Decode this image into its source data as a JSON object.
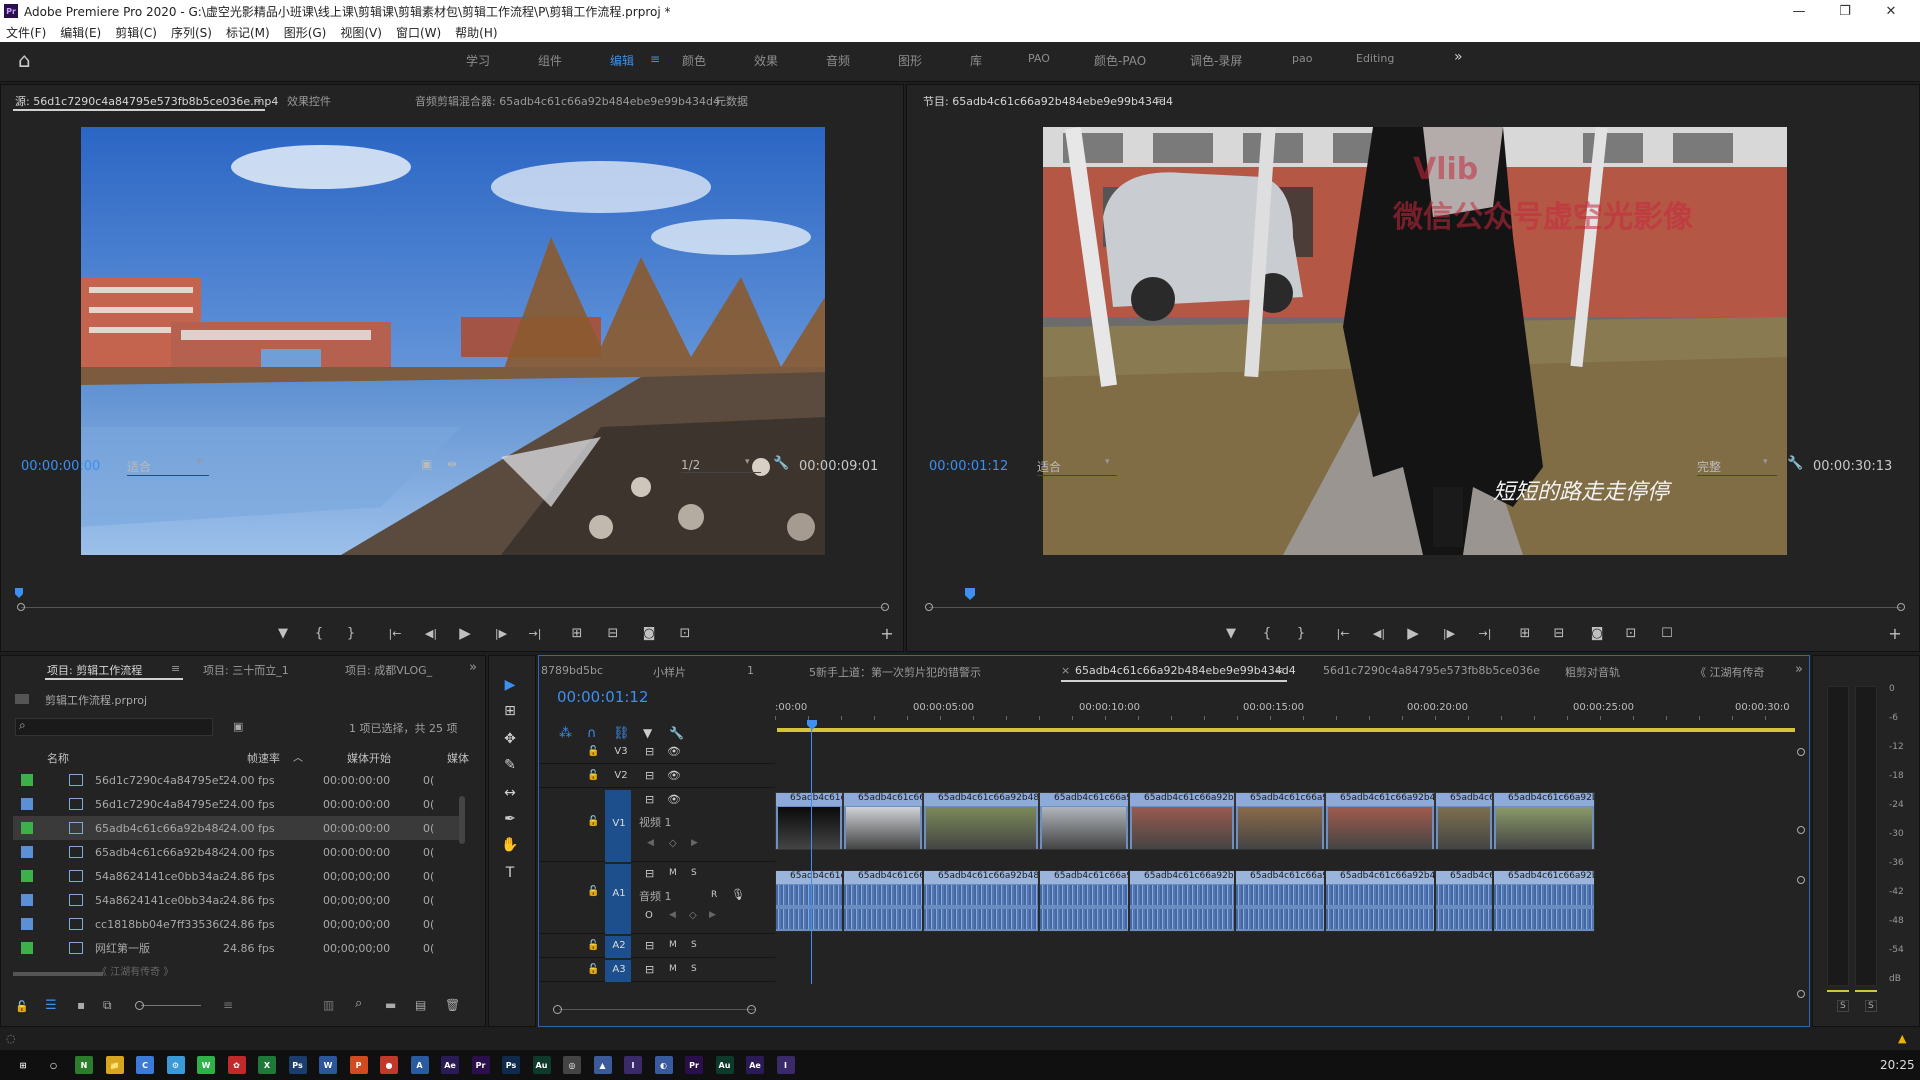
{
  "titlebar": {
    "app_icon": "Pr",
    "title": "Adobe Premiere Pro 2020 - G:\\虚空光影精品小班课\\线上课\\剪辑课\\剪辑素材包\\剪辑工作流程\\P\\剪辑工作流程.prproj *",
    "minimize": "—",
    "maximize": "❐",
    "close": "✕"
  },
  "menubar": [
    "文件(F)",
    "编辑(E)",
    "剪辑(C)",
    "序列(S)",
    "标记(M)",
    "图形(G)",
    "视图(V)",
    "窗口(W)",
    "帮助(H)"
  ],
  "workspaces": {
    "home_icon": "⌂",
    "tabs": [
      "学习",
      "组件",
      "编辑",
      "颜色",
      "效果",
      "音频",
      "图形",
      "库",
      "PAO",
      "颜色-PAO",
      "调色-录屏",
      "pao",
      "Editing"
    ],
    "active": "编辑",
    "active_menu": "≡",
    "overflow": "»"
  },
  "source_monitor": {
    "tabs": [
      "源: 56d1c7290c4a84795e573fb8b5ce036e.mp4",
      "效果控件",
      "音频剪辑混合器: 65adb4c61c66a92b484ebe9e99b434d4",
      "元数据"
    ],
    "tab_menu": "≡",
    "timecode": "00:00:00:00",
    "fit": "适合",
    "resolution": "1/2",
    "duration": "00:00:09:01"
  },
  "program_monitor": {
    "tab": "节目: 65adb4c61c66a92b484ebe9e99b434d4",
    "tab_menu": "≡",
    "timecode": "00:00:01:12",
    "fit": "适合",
    "quality": "完整",
    "duration": "00:00:30:13",
    "watermark_line1": "Vlib",
    "watermark_line2": "微信公众号虚空光影像",
    "subtitle": "短短的路走走停停"
  },
  "transport": {
    "marker": "▼",
    "in": "{",
    "out": "}",
    "goto_in": "|←",
    "step_back": "◀|",
    "play": "▶",
    "step_fwd": "|▶",
    "goto_out": "→|",
    "insert": "⊞",
    "overwrite": "⊟",
    "export_frame": "◙",
    "compare": "⊡",
    "add": "+"
  },
  "project_panel": {
    "tabs": [
      "项目: 剪辑工作流程",
      "项目: 三十而立_1",
      "项目: 成都VLOG_"
    ],
    "tab_menu": "≡",
    "overflow": "»",
    "project_file": "剪辑工作流程.prproj",
    "selection_info": "1 项已选择，共 25 项",
    "search_icon": "⌕",
    "col_name": "名称",
    "col_fps": "帧速率",
    "col_start": "媒体开始",
    "col_extra": "媒体",
    "rows": [
      {
        "name": "56d1c7290c4a84795e5",
        "fps": "24.00 fps",
        "start": "00:00:00:00",
        "swatch": "#3db04a",
        "kind": "seq"
      },
      {
        "name": "56d1c7290c4a84795e5",
        "fps": "24.00 fps",
        "start": "00:00:00:00",
        "swatch": "#5b8fd6",
        "kind": "clip"
      },
      {
        "name": "65adb4c61c66a92b484",
        "fps": "24.00 fps",
        "start": "00:00:00:00",
        "swatch": "#3db04a",
        "kind": "seq"
      },
      {
        "name": "65adb4c61c66a92b484",
        "fps": "24.00 fps",
        "start": "00:00:00:00",
        "swatch": "#5b8fd6",
        "kind": "clip"
      },
      {
        "name": "54a8624141ce0bb34aa",
        "fps": "24.86 fps",
        "start": "00;00;00;00",
        "swatch": "#3db04a",
        "kind": "seq"
      },
      {
        "name": "54a8624141ce0bb34aa",
        "fps": "24.86 fps",
        "start": "00;00;00;00",
        "swatch": "#5b8fd6",
        "kind": "clip"
      },
      {
        "name": "cc1818bb04e7ff3353609",
        "fps": "24.86 fps",
        "start": "00;00;00;00",
        "swatch": "#5b8fd6",
        "kind": "clip"
      },
      {
        "name": "网红第一版",
        "fps": "24.86 fps",
        "start": "00;00;00;00",
        "swatch": "#3db04a",
        "kind": "seq"
      }
    ],
    "row_extra": "0(",
    "partial_row": "《 江湖有传奇 》"
  },
  "tools": [
    "▶",
    "⊞",
    "✥",
    "✎",
    "↔",
    "✒",
    "✋",
    "T"
  ],
  "timeline": {
    "tabs": [
      "8789bd5bc",
      "小样片",
      "1",
      "5新手上道：第一次剪片犯的错警示",
      "65adb4c61c66a92b484ebe9e99b434d4",
      "56d1c7290c4a84795e573fb8b5ce036e",
      "粗剪对音轨",
      "《 江湖有传奇"
    ],
    "active_tab": "65adb4c61c66a92b484ebe9e99b434d4",
    "close_x": "×",
    "tab_menu": "≡",
    "overflow": "»",
    "timecode": "00:00:01:12",
    "ruler": [
      ":00:00",
      "00:00:05:00",
      "00:00:10:00",
      "00:00:15:00",
      "00:00:20:00",
      "00:00:25:00",
      "00:00:30:0"
    ],
    "tracks": {
      "v3": "V3",
      "v2": "V2",
      "v1": "V1",
      "v1_name": "视频 1",
      "a1": "A1",
      "a1_name": "音频 1",
      "a2": "A2",
      "a3": "A3",
      "m": "M",
      "s": "S",
      "r": "R"
    },
    "clip_labels": [
      "65adb4c61c",
      "65adb4c61c66a",
      "65adb4c61c66a92b484ebe",
      "65adb4c61c66a92b",
      "65adb4c61c66a92b484e",
      "65adb4c61c66a92b",
      "65adb4c61c66a92b484e",
      "65adb4c6",
      "65adb4c61c66a92b484"
    ],
    "meter_ticks": [
      "0",
      "-6",
      "-12",
      "-18",
      "-24",
      "-30",
      "-36",
      "-42",
      "-48",
      "-54",
      "dB"
    ],
    "meter_s1": "S",
    "meter_s2": "S"
  },
  "taskbar": {
    "clock": "20:25",
    "apps": [
      "⊞",
      "○",
      "N",
      "📁",
      "C",
      "⚙",
      "W",
      "✿",
      "X",
      "Ps",
      "W",
      "P",
      "●",
      "A",
      "Ae",
      "Pr",
      "Ps",
      "Au",
      "◎",
      "▲",
      "Ⅰ",
      "◐",
      "Pr",
      "Au",
      "Ae",
      "Ⅰ"
    ]
  },
  "colors": {
    "accent": "#3d8ff0",
    "clip_video": "#6e8fc0",
    "clip_audio": "#6b8cc0",
    "label_green": "#3db04a",
    "label_blue": "#5b8fd6",
    "work_area": "#d4c43a"
  }
}
